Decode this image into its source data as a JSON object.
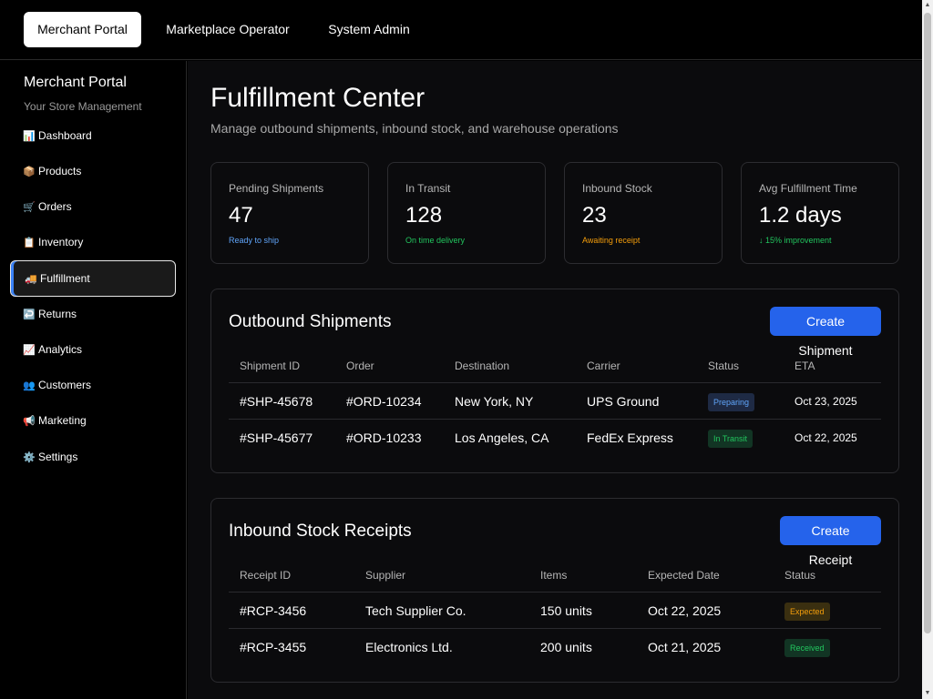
{
  "colors": {
    "accent": "#2563eb",
    "blue_note": "#60a5fa",
    "green_note": "#22c55e",
    "amber_note": "#f59e0b",
    "badge_preparing_bg": "#1e2a44",
    "badge_preparing_fg": "#60a5fa",
    "badge_transit_bg": "#123524",
    "badge_transit_fg": "#22c55e",
    "badge_expected_bg": "#3a2f10",
    "badge_expected_fg": "#f59e0b",
    "badge_received_bg": "#123524",
    "badge_received_fg": "#22c55e"
  },
  "topnav": {
    "tabs": [
      {
        "label": "Merchant Portal",
        "active": true
      },
      {
        "label": "Marketplace Operator",
        "active": false
      },
      {
        "label": "System Admin",
        "active": false
      }
    ]
  },
  "sidebar": {
    "title": "Merchant Portal",
    "subtitle": "Your Store Management",
    "items": [
      {
        "icon": "📊",
        "icon_name": "bar-chart-icon",
        "label": "Dashboard"
      },
      {
        "icon": "📦",
        "icon_name": "package-icon",
        "label": "Products"
      },
      {
        "icon": "🛒",
        "icon_name": "cart-icon",
        "label": "Orders"
      },
      {
        "icon": "📋",
        "icon_name": "clipboard-icon",
        "label": "Inventory"
      },
      {
        "icon": "🚚",
        "icon_name": "truck-icon",
        "label": "Fulfillment",
        "active": true
      },
      {
        "icon": "↩️",
        "icon_name": "return-arrow-icon",
        "label": "Returns"
      },
      {
        "icon": "📈",
        "icon_name": "trend-up-icon",
        "label": "Analytics"
      },
      {
        "icon": "👥",
        "icon_name": "users-icon",
        "label": "Customers"
      },
      {
        "icon": "📢",
        "icon_name": "megaphone-icon",
        "label": "Marketing"
      },
      {
        "icon": "⚙️",
        "icon_name": "gear-icon",
        "label": "Settings"
      }
    ]
  },
  "main": {
    "title": "Fulfillment Center",
    "subtitle": "Manage outbound shipments, inbound stock, and warehouse operations",
    "stats": [
      {
        "label": "Pending Shipments",
        "value": "47",
        "note": "Ready to ship",
        "note_color": "blue_note"
      },
      {
        "label": "In Transit",
        "value": "128",
        "note": "On time delivery",
        "note_color": "green_note"
      },
      {
        "label": "Inbound Stock",
        "value": "23",
        "note": "Awaiting receipt",
        "note_color": "amber_note"
      },
      {
        "label": "Avg Fulfillment Time",
        "value": "1.2 days",
        "note": "↓ 15% improvement",
        "note_color": "green_note"
      }
    ],
    "outbound": {
      "title": "Outbound Shipments",
      "button": "Create Shipment",
      "columns": [
        "Shipment ID",
        "Order",
        "Destination",
        "Carrier",
        "Status",
        "ETA"
      ],
      "rows": [
        [
          "#SHP-45678",
          "#ORD-10234",
          "New York, NY",
          "UPS Ground",
          "Preparing",
          "Oct 23, 2025"
        ],
        [
          "#SHP-45677",
          "#ORD-10233",
          "Los Angeles, CA",
          "FedEx Express",
          "In Transit",
          "Oct 22, 2025"
        ]
      ],
      "status_styles": [
        "preparing",
        "transit"
      ]
    },
    "inbound": {
      "title": "Inbound Stock Receipts",
      "button": "Create Receipt",
      "columns": [
        "Receipt ID",
        "Supplier",
        "Items",
        "Expected Date",
        "Status"
      ],
      "rows": [
        [
          "#RCP-3456",
          "Tech Supplier Co.",
          "150 units",
          "Oct 22, 2025",
          "Expected"
        ],
        [
          "#RCP-3455",
          "Electronics Ltd.",
          "200 units",
          "Oct 21, 2025",
          "Received"
        ]
      ],
      "status_styles": [
        "expected",
        "received"
      ]
    }
  },
  "scrollbar": {
    "up_icon": "▲",
    "down_icon": "▼"
  }
}
